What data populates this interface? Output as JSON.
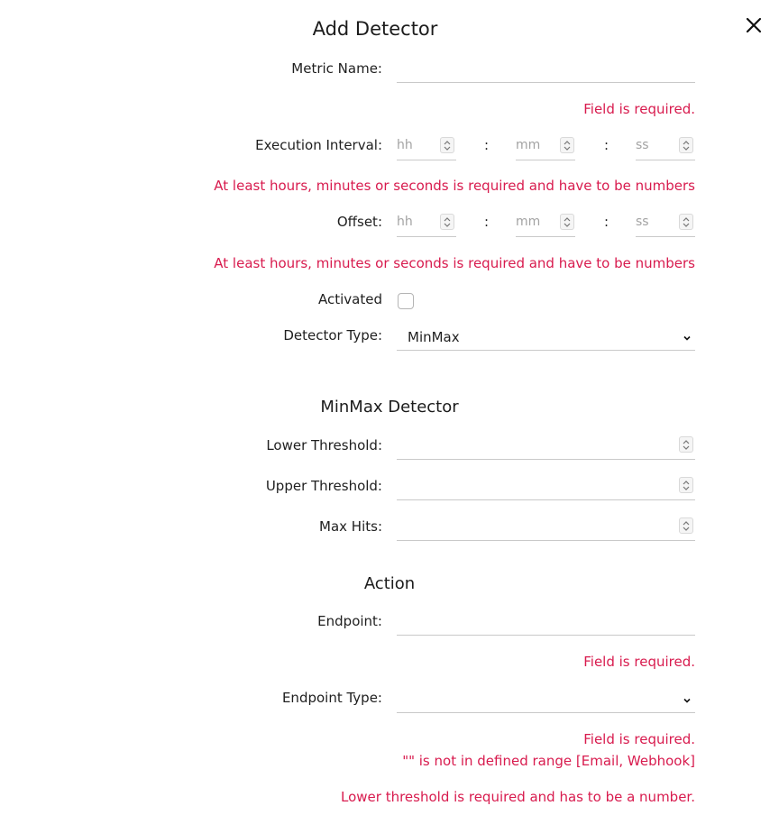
{
  "dialog": {
    "title": "Add Detector",
    "close_icon": "close-icon"
  },
  "fields": {
    "metric_name": {
      "label": "Metric Name:",
      "value": "",
      "error": "Field is required."
    },
    "execution_interval": {
      "label": "Execution Interval:",
      "placeholders": {
        "hh": "hh",
        "mm": "mm",
        "ss": "ss"
      },
      "separator": ":",
      "error": "At least hours, minutes or seconds is required and have to be numbers"
    },
    "offset": {
      "label": "Offset:",
      "placeholders": {
        "hh": "hh",
        "mm": "mm",
        "ss": "ss"
      },
      "separator": ":",
      "error": "At least hours, minutes or seconds is required and have to be numbers"
    },
    "activated": {
      "label": "Activated",
      "checked": false
    },
    "detector_type": {
      "label": "Detector Type:",
      "selected": "MinMax"
    }
  },
  "minmax": {
    "heading": "MinMax Detector",
    "lower_threshold": {
      "label": "Lower Threshold:",
      "value": ""
    },
    "upper_threshold": {
      "label": "Upper Threshold:",
      "value": ""
    },
    "max_hits": {
      "label": "Max Hits:",
      "value": ""
    }
  },
  "action": {
    "heading": "Action",
    "endpoint": {
      "label": "Endpoint:",
      "value": "",
      "error": "Field is required."
    },
    "endpoint_type": {
      "label": "Endpoint Type:",
      "selected": "",
      "error_required": "Field is required.",
      "error_range": "\"\" is not in defined range [Email, Webhook]"
    }
  },
  "form_error": "Lower threshold is required and has to be a number.",
  "colors": {
    "error": "#d81b4e",
    "border": "#c9c9c9",
    "text": "#1f1f1f",
    "placeholder": "#a3a3a3"
  }
}
